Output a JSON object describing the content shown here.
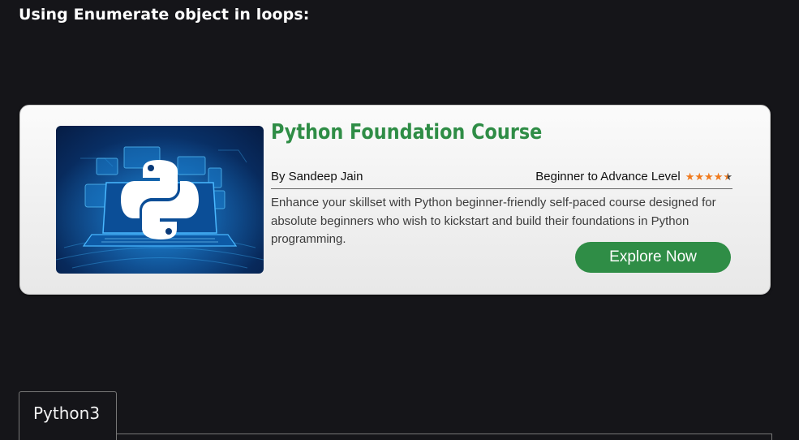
{
  "article": {
    "heading": "Using Enumerate object in loops:"
  },
  "course_card": {
    "image_icon": "python-logo-laptop-icon",
    "title": "Python Foundation Course",
    "author": "By Sandeep Jain",
    "level": "Beginner to Advance Level",
    "rating": 4.5,
    "rating_max": 5,
    "description": "Enhance your skillset with Python beginner-friendly self-paced course designed for absolute beginners who wish to kickstart and build their foundations in Python programming.",
    "button_label": "Explore Now",
    "accent_color": "#2f8d46",
    "star_color": "#f07a1d"
  },
  "code_tabs": [
    {
      "label": "Python3"
    }
  ]
}
